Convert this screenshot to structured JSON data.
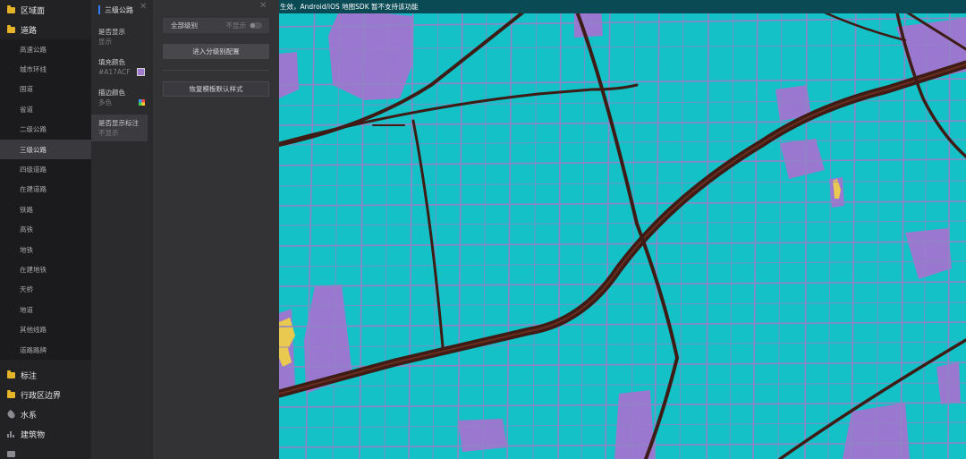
{
  "sidebar": {
    "top_categories": [
      {
        "label": "区域面",
        "icon": "folder-icon"
      },
      {
        "label": "道路",
        "icon": "folder-open-icon"
      }
    ],
    "road_items": [
      {
        "label": "高速公路"
      },
      {
        "label": "城市环线"
      },
      {
        "label": "国道"
      },
      {
        "label": "省道"
      },
      {
        "label": "二级公路"
      },
      {
        "label": "三级公路",
        "active": true
      },
      {
        "label": "四级道路"
      },
      {
        "label": "在建道路"
      },
      {
        "label": "铁路"
      },
      {
        "label": "高铁"
      },
      {
        "label": "地铁"
      },
      {
        "label": "在建地铁"
      },
      {
        "label": "天桥"
      },
      {
        "label": "地道"
      },
      {
        "label": "其他线路"
      },
      {
        "label": "道路路牌"
      }
    ],
    "bottom_categories": [
      {
        "label": "标注",
        "icon": "folder-icon"
      },
      {
        "label": "行政区边界",
        "icon": "folder-icon"
      },
      {
        "label": "水系",
        "icon": "water-drop-icon"
      },
      {
        "label": "建筑物",
        "icon": "building-icon"
      },
      {
        "label": "",
        "icon": "category-icon"
      }
    ]
  },
  "props": {
    "title": "三级公路",
    "items": [
      {
        "label": "是否显示",
        "value": "显示"
      },
      {
        "label": "填充颜色",
        "value": "#A17ACF"
      },
      {
        "label": "描边颜色",
        "value": "多色"
      },
      {
        "label": "是否显示标注",
        "value": "不显示"
      }
    ]
  },
  "panel": {
    "all_levels_label": "全部级别",
    "all_levels_toggle": "不显示",
    "enter_level_config": "进入分级别配置",
    "reset_template": "恢复模板默认样式"
  },
  "map": {
    "notice": "生效，Android/iOS 地图SDK 暂不支持该功能",
    "colors": {
      "ground": "#13c1c6",
      "road": "#9184c6",
      "area": "#9b78cf",
      "main_road": "#3e1c15",
      "highlight": "#e9c94f"
    }
  },
  "colors": {
    "fill_swatch": "#A17ACF",
    "accent": "#2f7fff"
  }
}
